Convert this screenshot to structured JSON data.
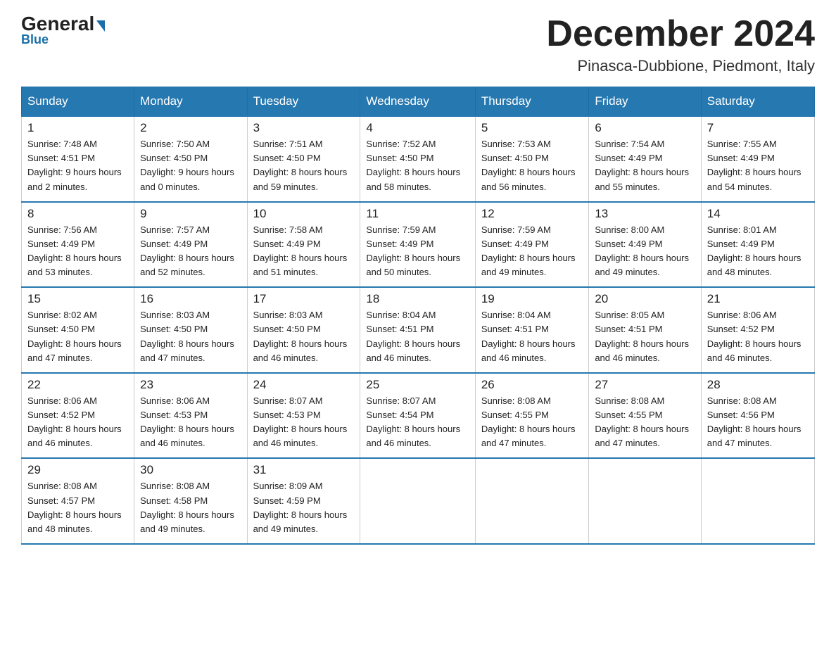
{
  "header": {
    "logo_general": "General",
    "logo_blue": "Blue",
    "month_title": "December 2024",
    "location": "Pinasca-Dubbione, Piedmont, Italy"
  },
  "days_of_week": [
    "Sunday",
    "Monday",
    "Tuesday",
    "Wednesday",
    "Thursday",
    "Friday",
    "Saturday"
  ],
  "weeks": [
    [
      {
        "day": "1",
        "sunrise": "7:48 AM",
        "sunset": "4:51 PM",
        "daylight": "9 hours and 2 minutes."
      },
      {
        "day": "2",
        "sunrise": "7:50 AM",
        "sunset": "4:50 PM",
        "daylight": "9 hours and 0 minutes."
      },
      {
        "day": "3",
        "sunrise": "7:51 AM",
        "sunset": "4:50 PM",
        "daylight": "8 hours and 59 minutes."
      },
      {
        "day": "4",
        "sunrise": "7:52 AM",
        "sunset": "4:50 PM",
        "daylight": "8 hours and 58 minutes."
      },
      {
        "day": "5",
        "sunrise": "7:53 AM",
        "sunset": "4:50 PM",
        "daylight": "8 hours and 56 minutes."
      },
      {
        "day": "6",
        "sunrise": "7:54 AM",
        "sunset": "4:49 PM",
        "daylight": "8 hours and 55 minutes."
      },
      {
        "day": "7",
        "sunrise": "7:55 AM",
        "sunset": "4:49 PM",
        "daylight": "8 hours and 54 minutes."
      }
    ],
    [
      {
        "day": "8",
        "sunrise": "7:56 AM",
        "sunset": "4:49 PM",
        "daylight": "8 hours and 53 minutes."
      },
      {
        "day": "9",
        "sunrise": "7:57 AM",
        "sunset": "4:49 PM",
        "daylight": "8 hours and 52 minutes."
      },
      {
        "day": "10",
        "sunrise": "7:58 AM",
        "sunset": "4:49 PM",
        "daylight": "8 hours and 51 minutes."
      },
      {
        "day": "11",
        "sunrise": "7:59 AM",
        "sunset": "4:49 PM",
        "daylight": "8 hours and 50 minutes."
      },
      {
        "day": "12",
        "sunrise": "7:59 AM",
        "sunset": "4:49 PM",
        "daylight": "8 hours and 49 minutes."
      },
      {
        "day": "13",
        "sunrise": "8:00 AM",
        "sunset": "4:49 PM",
        "daylight": "8 hours and 49 minutes."
      },
      {
        "day": "14",
        "sunrise": "8:01 AM",
        "sunset": "4:49 PM",
        "daylight": "8 hours and 48 minutes."
      }
    ],
    [
      {
        "day": "15",
        "sunrise": "8:02 AM",
        "sunset": "4:50 PM",
        "daylight": "8 hours and 47 minutes."
      },
      {
        "day": "16",
        "sunrise": "8:03 AM",
        "sunset": "4:50 PM",
        "daylight": "8 hours and 47 minutes."
      },
      {
        "day": "17",
        "sunrise": "8:03 AM",
        "sunset": "4:50 PM",
        "daylight": "8 hours and 46 minutes."
      },
      {
        "day": "18",
        "sunrise": "8:04 AM",
        "sunset": "4:51 PM",
        "daylight": "8 hours and 46 minutes."
      },
      {
        "day": "19",
        "sunrise": "8:04 AM",
        "sunset": "4:51 PM",
        "daylight": "8 hours and 46 minutes."
      },
      {
        "day": "20",
        "sunrise": "8:05 AM",
        "sunset": "4:51 PM",
        "daylight": "8 hours and 46 minutes."
      },
      {
        "day": "21",
        "sunrise": "8:06 AM",
        "sunset": "4:52 PM",
        "daylight": "8 hours and 46 minutes."
      }
    ],
    [
      {
        "day": "22",
        "sunrise": "8:06 AM",
        "sunset": "4:52 PM",
        "daylight": "8 hours and 46 minutes."
      },
      {
        "day": "23",
        "sunrise": "8:06 AM",
        "sunset": "4:53 PM",
        "daylight": "8 hours and 46 minutes."
      },
      {
        "day": "24",
        "sunrise": "8:07 AM",
        "sunset": "4:53 PM",
        "daylight": "8 hours and 46 minutes."
      },
      {
        "day": "25",
        "sunrise": "8:07 AM",
        "sunset": "4:54 PM",
        "daylight": "8 hours and 46 minutes."
      },
      {
        "day": "26",
        "sunrise": "8:08 AM",
        "sunset": "4:55 PM",
        "daylight": "8 hours and 47 minutes."
      },
      {
        "day": "27",
        "sunrise": "8:08 AM",
        "sunset": "4:55 PM",
        "daylight": "8 hours and 47 minutes."
      },
      {
        "day": "28",
        "sunrise": "8:08 AM",
        "sunset": "4:56 PM",
        "daylight": "8 hours and 47 minutes."
      }
    ],
    [
      {
        "day": "29",
        "sunrise": "8:08 AM",
        "sunset": "4:57 PM",
        "daylight": "8 hours and 48 minutes."
      },
      {
        "day": "30",
        "sunrise": "8:08 AM",
        "sunset": "4:58 PM",
        "daylight": "8 hours and 49 minutes."
      },
      {
        "day": "31",
        "sunrise": "8:09 AM",
        "sunset": "4:59 PM",
        "daylight": "8 hours and 49 minutes."
      },
      null,
      null,
      null,
      null
    ]
  ]
}
